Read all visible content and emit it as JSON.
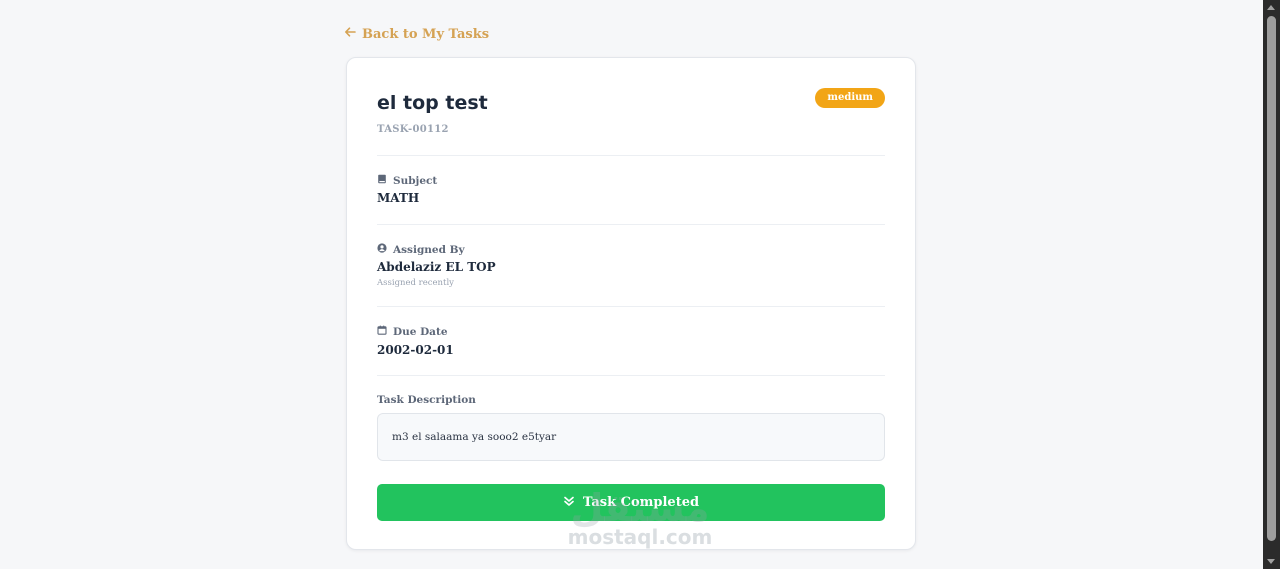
{
  "back_link": {
    "label": "Back to My Tasks",
    "icon": "arrow-left-icon"
  },
  "task": {
    "title": "el top test",
    "id": "TASK-00112",
    "priority": "medium"
  },
  "fields": {
    "subject": {
      "label": "Subject",
      "icon": "book-icon",
      "value": "MATH"
    },
    "assigned_by": {
      "label": "Assigned By",
      "icon": "user-circle-icon",
      "value": "Abdelaziz EL TOP",
      "sub": "Assigned recently"
    },
    "due_date": {
      "label": "Due Date",
      "icon": "calendar-icon",
      "value": "2002-02-01"
    }
  },
  "description": {
    "label": "Task Description",
    "text": "m3 el salaama ya sooo2 e5tyar"
  },
  "complete_button": {
    "label": "Task Completed",
    "icon": "double-check-icon"
  },
  "watermark": {
    "arabic": "مستقل",
    "latin": "mostaql.com"
  },
  "colors": {
    "accent_gold": "#d5a253",
    "priority_medium": "#f2a516",
    "success_green": "#22c35e",
    "heading": "#1e2a3c",
    "background": "#f6f7f9"
  }
}
